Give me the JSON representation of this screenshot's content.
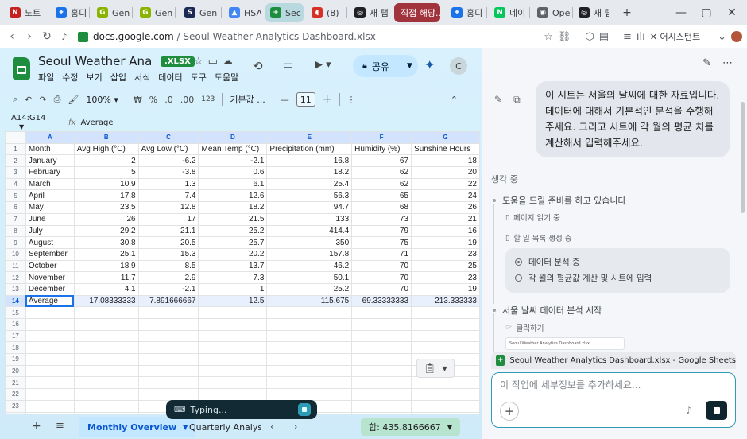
{
  "browser": {
    "tabs": [
      {
        "label": "노트",
        "icon_color": "#c5221f",
        "icon_letter": "N"
      },
      {
        "label": "홍디",
        "icon_color": "#1a73e8",
        "icon_letter": "⌖"
      },
      {
        "label": "Gen",
        "icon_color": "#8ab400",
        "icon_letter": "G"
      },
      {
        "label": "Gen",
        "icon_color": "#8ab400",
        "icon_letter": "G"
      },
      {
        "label": "Gen",
        "icon_color": "#1a2a52",
        "icon_letter": "S"
      },
      {
        "label": "HSA",
        "icon_color": "#4285f4",
        "icon_letter": "▲"
      },
      {
        "label": "Sec",
        "icon_color": "#1e8e3e",
        "icon_letter": "+"
      },
      {
        "label": "(8)",
        "icon_color": "#d93025",
        "icon_letter": "◖"
      },
      {
        "label": "새 탭",
        "icon_color": "#202124",
        "icon_letter": "◎"
      },
      {
        "label": "직접 해당...",
        "icon_color": "",
        "icon_letter": ""
      },
      {
        "label": "홍디",
        "icon_color": "#1a73e8",
        "icon_letter": "⌖"
      },
      {
        "label": "네이",
        "icon_color": "#03c75a",
        "icon_letter": "N"
      },
      {
        "label": "Ope",
        "icon_color": "#5f6368",
        "icon_letter": "◉"
      },
      {
        "label": "새 탭",
        "icon_color": "#202124",
        "icon_letter": "◎"
      }
    ],
    "new_tab": "+",
    "url_host": "docs.google.com",
    "url_path": " / Seoul Weather Analytics Dashboard.xlsx",
    "assistant_label": "어시스턴트"
  },
  "sheets": {
    "title": "Seoul Weather Analytics Dashboard",
    "badge": ".XLSX",
    "menu": [
      "파일",
      "수정",
      "보기",
      "삽입",
      "서식",
      "데이터",
      "도구",
      "도움말"
    ],
    "share_label": "공유",
    "avatar_letter": "C",
    "toolbar": {
      "zoom": "100%",
      "currency": "₩",
      "percent": "%",
      "dec_minus": ".0",
      "dec_plus": ".00",
      "number_fmt": "123",
      "font": "기본값 ...",
      "minus": "—",
      "font_size": "11",
      "plus": "+"
    },
    "name_box": "A14:G14",
    "formula": "Average",
    "columns": [
      "A",
      "B",
      "C",
      "D",
      "E",
      "F",
      "G"
    ],
    "rows": [
      [
        "Month",
        "Avg High (°C)",
        "Avg Low (°C)",
        "Mean Temp (°C)",
        "Precipitation (mm)",
        "Humidity (%)",
        "Sunshine Hours"
      ],
      [
        "January",
        "2",
        "-6.2",
        "-2.1",
        "16.8",
        "67",
        "18"
      ],
      [
        "February",
        "5",
        "-3.8",
        "0.6",
        "18.2",
        "62",
        "20"
      ],
      [
        "March",
        "10.9",
        "1.3",
        "6.1",
        "25.4",
        "62",
        "22"
      ],
      [
        "April",
        "17.8",
        "7.4",
        "12.6",
        "56.3",
        "65",
        "24"
      ],
      [
        "May",
        "23.5",
        "12.8",
        "18.2",
        "94.7",
        "68",
        "26"
      ],
      [
        "June",
        "26",
        "17",
        "21.5",
        "133",
        "73",
        "21"
      ],
      [
        "July",
        "29.2",
        "21.1",
        "25.2",
        "414.4",
        "79",
        "16"
      ],
      [
        "August",
        "30.8",
        "20.5",
        "25.7",
        "350",
        "75",
        "19"
      ],
      [
        "September",
        "25.1",
        "15.3",
        "20.2",
        "157.8",
        "71",
        "23"
      ],
      [
        "October",
        "18.9",
        "8.5",
        "13.7",
        "46.2",
        "70",
        "25"
      ],
      [
        "November",
        "11.7",
        "2.9",
        "7.3",
        "50.1",
        "70",
        "23"
      ],
      [
        "December",
        "4.1",
        "-2.1",
        "1",
        "25.2",
        "70",
        "19"
      ],
      [
        "Average",
        "17.08333333",
        "7.891666667",
        "12.5",
        "115.675",
        "69.33333333",
        "213.333333"
      ],
      [
        "",
        "",
        "",
        "",
        "",
        "",
        ""
      ],
      [
        "",
        "",
        "",
        "",
        "",
        "",
        ""
      ],
      [
        "",
        "",
        "",
        "",
        "",
        "",
        ""
      ],
      [
        "",
        "",
        "",
        "",
        "",
        "",
        ""
      ],
      [
        "",
        "",
        "",
        "",
        "",
        "",
        ""
      ],
      [
        "",
        "",
        "",
        "",
        "",
        "",
        ""
      ],
      [
        "",
        "",
        "",
        "",
        "",
        "",
        ""
      ],
      [
        "",
        "",
        "",
        "",
        "",
        "",
        ""
      ],
      [
        "",
        "",
        "",
        "",
        "",
        "",
        ""
      ],
      [
        "",
        "",
        "",
        "",
        "",
        "",
        ""
      ]
    ],
    "selected_row": 14,
    "sheet_tabs": [
      "Monthly Overview",
      "Quarterly Analysis"
    ],
    "sum_label": "합: 435.8166667",
    "typing_label": "Typing..."
  },
  "assistant": {
    "user_message": "이 시트는 서울의 날씨에 대한 자료입니다. 데이터에 대해서 기본적인 분석을 수행해주세요. 그리고 시트에 각 월의 평균 치를 계산해서 입력해주세요.",
    "thinking_label": "생각 중",
    "step1": "도움을 드릴 준비를 하고 있습니다",
    "sub_read": "페이지 읽기 중",
    "sub_todo": "할 일 목록 생성 중",
    "todos": [
      "데이터 분석 중",
      "각 월의 평균값 계산 및 시트에 입력"
    ],
    "step2": "서울 날씨 데이터 분석 시작",
    "sub_click": "클릭하기",
    "thumb_text": "Seoul Weather Analytics Dashboard.xlsx",
    "context_chip": "Seoul Weather Analytics Dashboard.xlsx - Google Sheets",
    "input_placeholder": "이 작업에 세부정보를 추가하세요..."
  }
}
